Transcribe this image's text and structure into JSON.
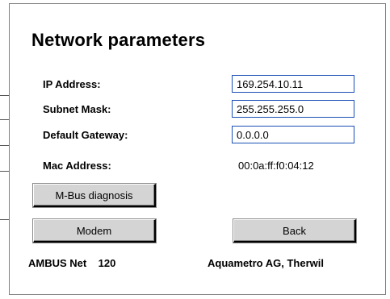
{
  "page": {
    "title": "Network parameters"
  },
  "fields": {
    "ip_address": {
      "label": "IP Address:",
      "value": "169.254.10.11"
    },
    "subnet_mask": {
      "label": "Subnet Mask:",
      "value": "255.255.255.0"
    },
    "default_gateway": {
      "label": "Default Gateway:",
      "value": "0.0.0.0"
    },
    "mac_address": {
      "label": "Mac Address:",
      "value": "00:0a:ff:f0:04:12"
    }
  },
  "buttons": {
    "mbus_diagnosis": "M-Bus diagnosis",
    "modem": "Modem",
    "back": "Back"
  },
  "footer": {
    "product": "AMBUS Net    120",
    "company": "Aquametro AG, Therwil"
  },
  "colors": {
    "input_border": "#1a4fb5",
    "button_face": "#d4d4d4"
  }
}
